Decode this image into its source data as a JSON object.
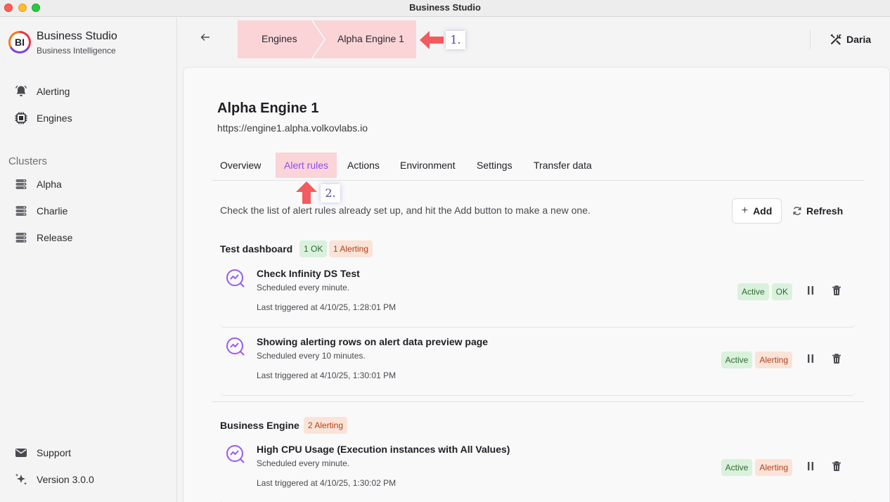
{
  "window": {
    "title": "Business Studio"
  },
  "sidebar": {
    "brand": {
      "logo_text": "BI",
      "title": "Business Studio",
      "subtitle": "Business Intelligence"
    },
    "nav": [
      {
        "label": "Alerting",
        "icon": "bell-icon"
      },
      {
        "label": "Engines",
        "icon": "chip-icon"
      }
    ],
    "clusters_heading": "Clusters",
    "clusters": [
      {
        "label": "Alpha",
        "icon": "server-icon"
      },
      {
        "label": "Charlie",
        "icon": "server-icon"
      },
      {
        "label": "Release",
        "icon": "server-icon"
      }
    ],
    "footer": [
      {
        "label": "Support",
        "icon": "mail-icon"
      },
      {
        "label": "Version 3.0.0",
        "icon": "sparkle-icon"
      }
    ]
  },
  "header": {
    "breadcrumb": [
      "Engines",
      "Alpha Engine 1"
    ],
    "annotation_1": "1.",
    "user": "Daria"
  },
  "engine": {
    "title": "Alpha Engine 1",
    "url": "https://engine1.alpha.volkovlabs.io"
  },
  "tabs": [
    "Overview",
    "Alert rules",
    "Actions",
    "Environment",
    "Settings",
    "Transfer data"
  ],
  "active_tab": "Alert rules",
  "annotation_2": "2.",
  "description": "Check the list of alert rules already set up, and hit the Add button to make a new one.",
  "buttons": {
    "add": "Add",
    "refresh": "Refresh"
  },
  "groups": [
    {
      "title": "Test dashboard",
      "badges": [
        "1 OK",
        "1 Alerting"
      ],
      "rules": [
        {
          "name": "Check Infinity DS Test",
          "schedule": "Scheduled every minute.",
          "last": "Last triggered at 4/10/25, 1:28:01 PM",
          "state": "Active",
          "status": "OK"
        },
        {
          "name": "Showing alerting rows on alert data preview page",
          "schedule": "Scheduled every 10 minutes.",
          "last": "Last triggered at 4/10/25, 1:30:01 PM",
          "state": "Active",
          "status": "Alerting"
        }
      ]
    },
    {
      "title": "Business Engine",
      "badges": [
        "2 Alerting"
      ],
      "rules": [
        {
          "name": "High CPU Usage (Execution instances with All Values)",
          "schedule": "Scheduled every minute.",
          "last": "Last triggered at 4/10/25, 1:30:02 PM",
          "state": "Active",
          "status": "Alerting"
        }
      ]
    }
  ],
  "colors": {
    "accent": "#8a4ff0",
    "highlight": "#fad4d7",
    "ok_bg": "#daf1dc",
    "alert_bg": "#fbe3d8",
    "annotation_arrow": "#f25b5f"
  }
}
